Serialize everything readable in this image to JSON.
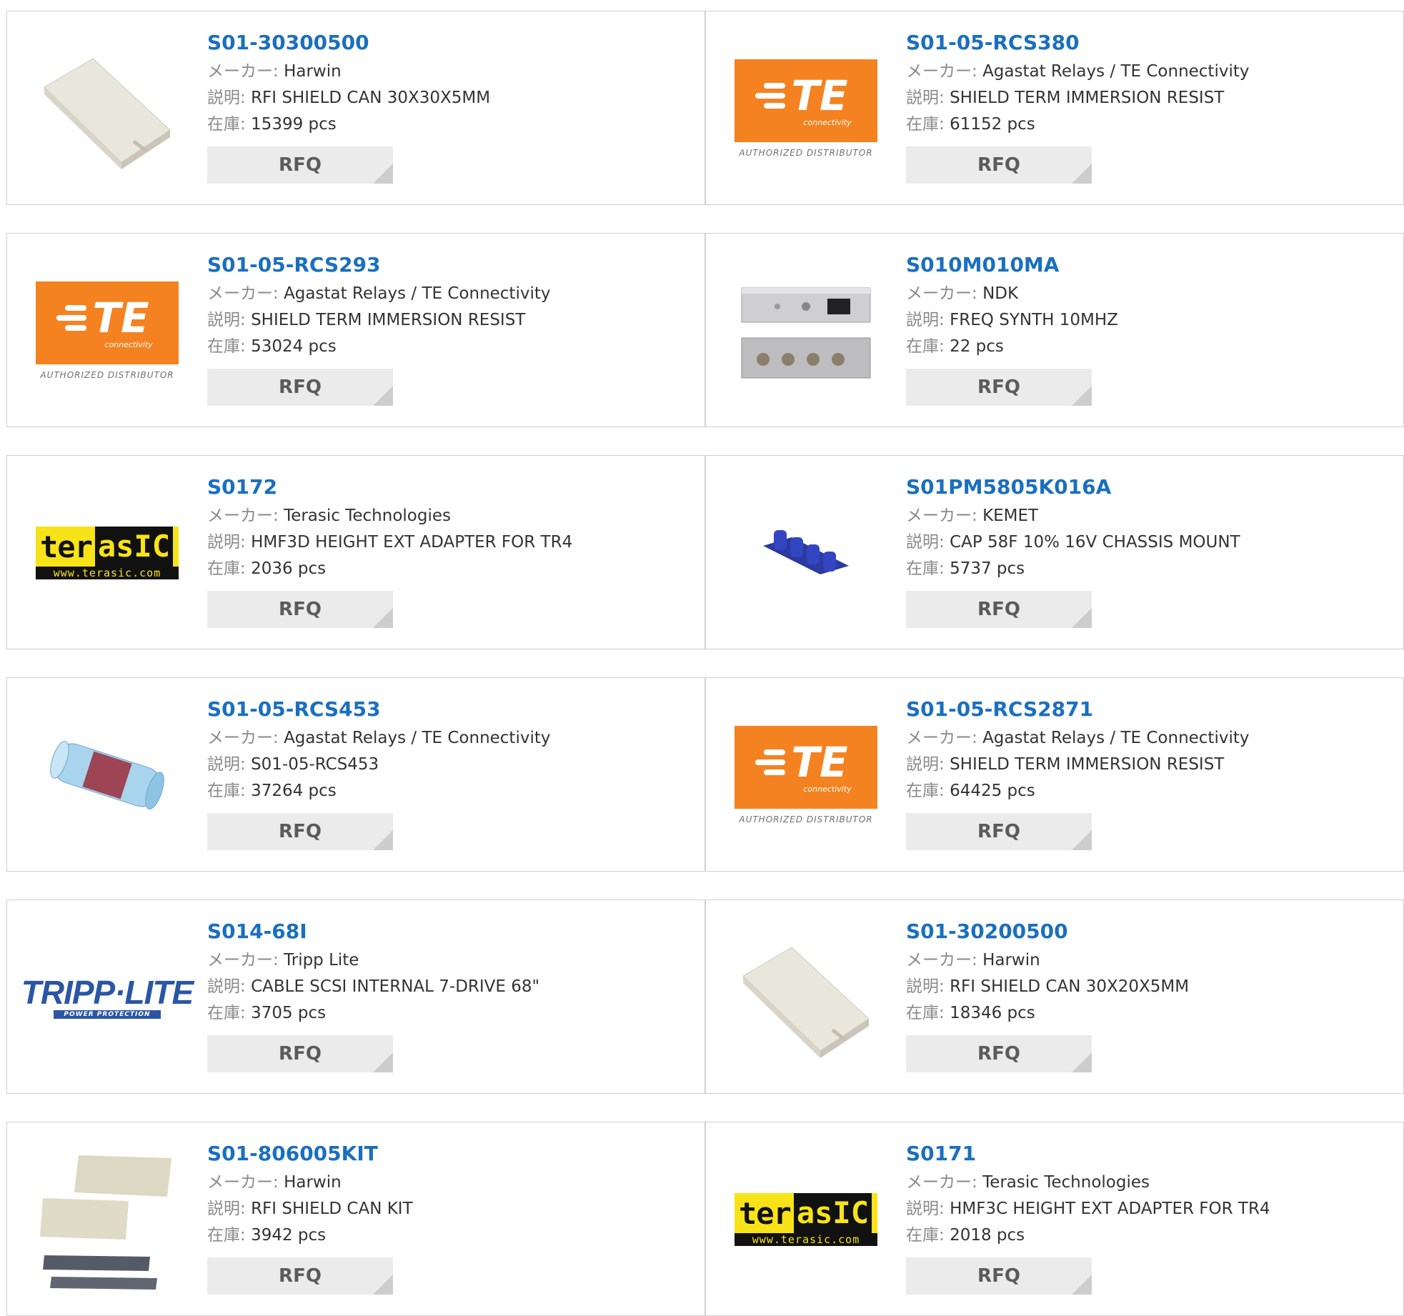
{
  "labels": {
    "maker": "メーカー:",
    "desc": "説明:",
    "stock": "在庫:"
  },
  "rfq_label": "RFQ",
  "logos": {
    "te_text": "TE",
    "te_sub": "connectivity",
    "te_auth": "AUTHORIZED DISTRIBUTOR",
    "terasic_a": "ter",
    "terasic_b": "asIC",
    "terasic_url": "www.terasic.com",
    "tripp_text": "TRIPP·LITE",
    "tripp_sub": "POWER PROTECTION"
  },
  "products": [
    {
      "pn": "S01-30300500",
      "maker": "Harwin",
      "desc": "RFI SHIELD CAN 30X30X5MM",
      "stock": "15399 pcs",
      "image": "shield-can"
    },
    {
      "pn": "S01-05-RCS380",
      "maker": "Agastat Relays / TE Connectivity",
      "desc": "SHIELD TERM IMMERSION RESIST",
      "stock": "61152 pcs",
      "image": "te-logo"
    },
    {
      "pn": "S01-05-RCS293",
      "maker": "Agastat Relays / TE Connectivity",
      "desc": "SHIELD TERM IMMERSION RESIST",
      "stock": "53024 pcs",
      "image": "te-logo"
    },
    {
      "pn": "S010M010MA",
      "maker": "NDK",
      "desc": "FREQ SYNTH 10MHZ",
      "stock": "22 pcs",
      "image": "freq-synth"
    },
    {
      "pn": "S0172",
      "maker": "Terasic Technologies",
      "desc": "HMF3D HEIGHT EXT ADAPTER FOR TR4",
      "stock": "2036 pcs",
      "image": "terasic-logo"
    },
    {
      "pn": "S01PM5805K016A",
      "maker": "KEMET",
      "desc": "CAP 58F 10% 16V CHASSIS MOUNT",
      "stock": "5737 pcs",
      "image": "capacitor"
    },
    {
      "pn": "S01-05-RCS453",
      "maker": "Agastat Relays / TE Connectivity",
      "desc": "S01-05-RCS453",
      "stock": "37264 pcs",
      "image": "tube"
    },
    {
      "pn": "S01-05-RCS2871",
      "maker": "Agastat Relays / TE Connectivity",
      "desc": "SHIELD TERM IMMERSION RESIST",
      "stock": "64425 pcs",
      "image": "te-logo"
    },
    {
      "pn": "S014-68I",
      "maker": "Tripp Lite",
      "desc": "CABLE SCSI INTERNAL 7-DRIVE 68\"",
      "stock": "3705 pcs",
      "image": "tripp-logo"
    },
    {
      "pn": "S01-30200500",
      "maker": "Harwin",
      "desc": "RFI SHIELD CAN 30X20X5MM",
      "stock": "18346 pcs",
      "image": "shield-can"
    },
    {
      "pn": "S01-806005KIT",
      "maker": "Harwin",
      "desc": "RFI SHIELD CAN KIT",
      "stock": "3942 pcs",
      "image": "shield-kit"
    },
    {
      "pn": "S0171",
      "maker": "Terasic Technologies",
      "desc": "HMF3C HEIGHT EXT ADAPTER FOR TR4",
      "stock": "2018 pcs",
      "image": "terasic-logo"
    }
  ]
}
